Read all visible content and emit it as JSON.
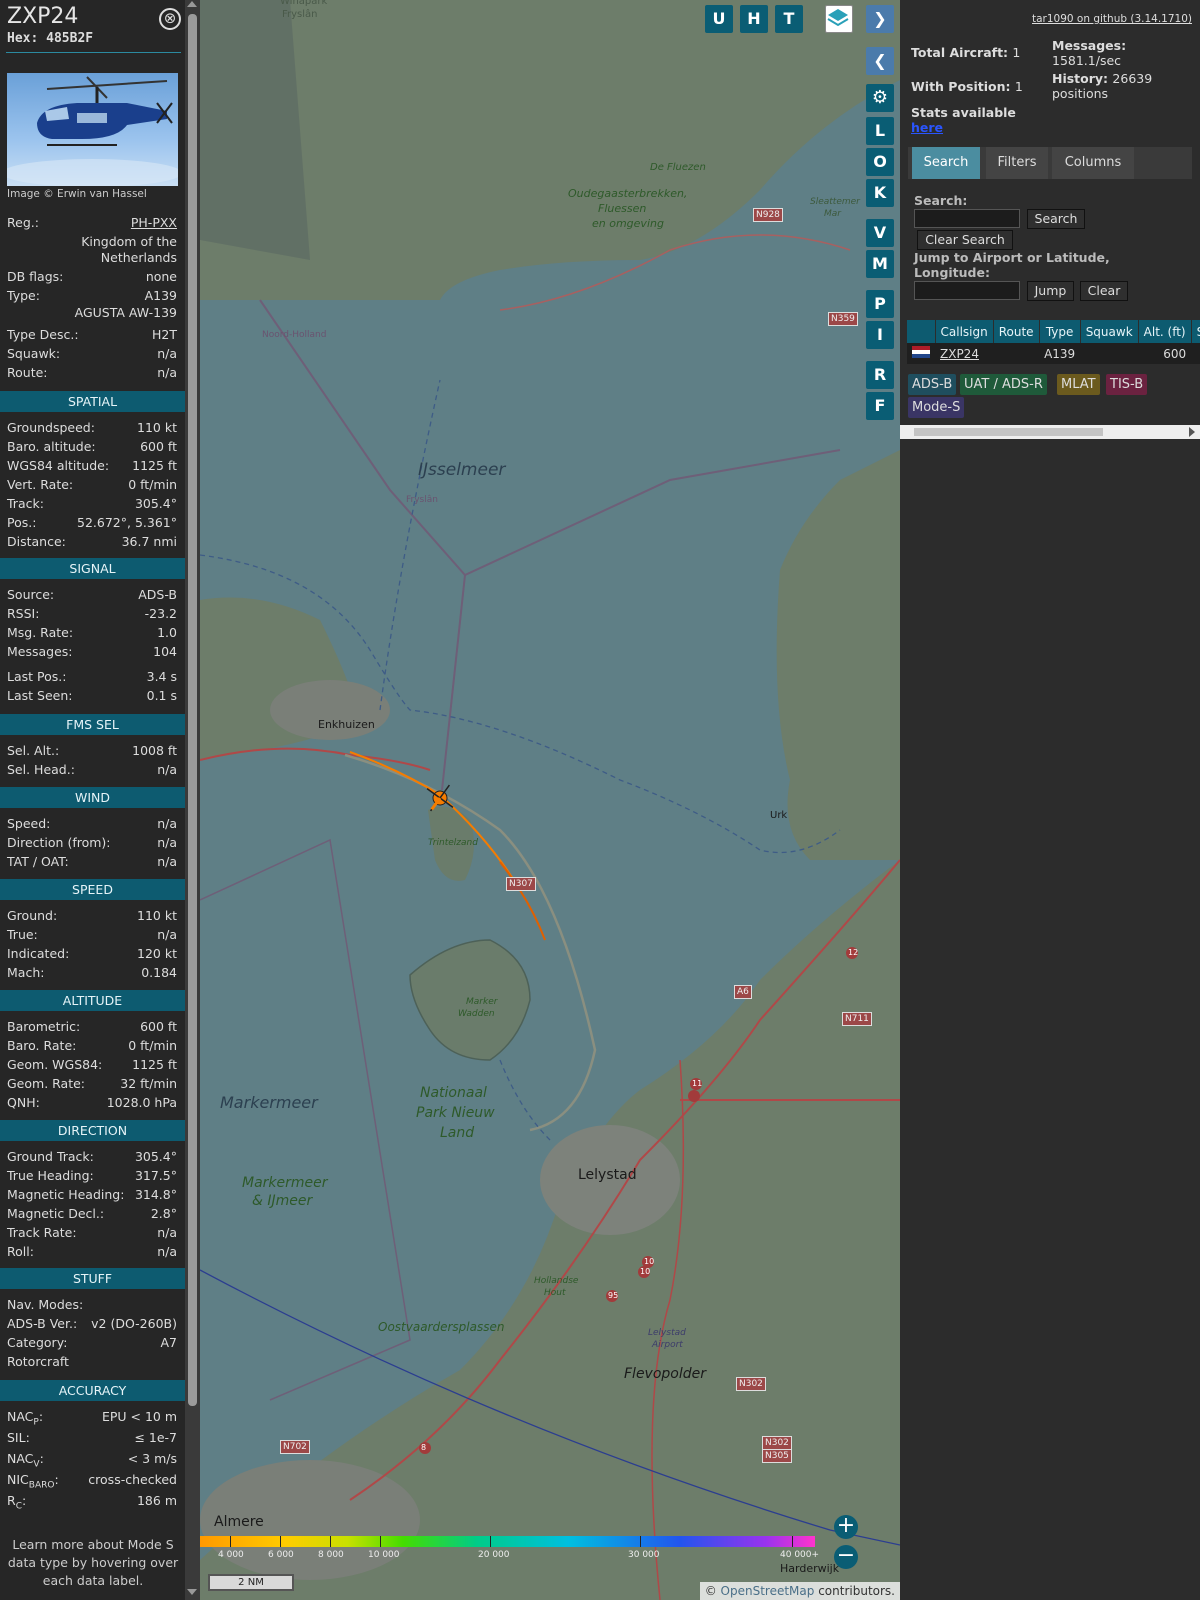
{
  "detail": {
    "callsign": "ZXP24",
    "hex_label": "Hex:",
    "hex": "485B2F",
    "close_glyph": "⊗",
    "photo_credit": "Image © Erwin van Hassel",
    "reg_label": "Reg.:",
    "reg": "PH-PXX",
    "country_line1": "Kingdom of the",
    "country_line2": "Netherlands",
    "rows_top": [
      {
        "k": "DB flags:",
        "v": "none"
      },
      {
        "k": "Type:",
        "v": "A139"
      }
    ],
    "type_full": "AGUSTA AW-139",
    "rows_type": [
      {
        "k": "Type Desc.:",
        "v": "H2T"
      },
      {
        "k": "Squawk:",
        "v": "n/a"
      },
      {
        "k": "Route:",
        "v": "n/a"
      }
    ],
    "sections": {
      "spatial": "SPATIAL",
      "signal": "SIGNAL",
      "fms": "FMS SEL",
      "wind": "WIND",
      "speed": "SPEED",
      "altitude": "ALTITUDE",
      "direction": "DIRECTION",
      "stuff": "STUFF",
      "accuracy": "ACCURACY"
    },
    "spatial": [
      {
        "k": "Groundspeed:",
        "v": "110 kt"
      },
      {
        "k": "Baro. altitude:",
        "v": "600 ft"
      },
      {
        "k": "WGS84 altitude:",
        "v": "1125 ft"
      },
      {
        "k": "Vert. Rate:",
        "v": "0 ft/min"
      },
      {
        "k": "Track:",
        "v": "305.4°"
      },
      {
        "k": "Pos.:",
        "v": "52.672°, 5.361°"
      },
      {
        "k": "Distance:",
        "v": "36.7 nmi"
      }
    ],
    "signal": [
      {
        "k": "Source:",
        "v": "ADS-B"
      },
      {
        "k": "RSSI:",
        "v": "-23.2"
      },
      {
        "k": "Msg. Rate:",
        "v": "1.0"
      },
      {
        "k": "Messages:",
        "v": "104"
      },
      {
        "k": "Last Pos.:",
        "v": "3.4 s"
      },
      {
        "k": "Last Seen:",
        "v": "0.1 s"
      }
    ],
    "fms": [
      {
        "k": "Sel. Alt.:",
        "v": "1008 ft"
      },
      {
        "k": "Sel. Head.:",
        "v": "n/a"
      }
    ],
    "wind": [
      {
        "k": "Speed:",
        "v": "n/a"
      },
      {
        "k": "Direction (from):",
        "v": "n/a"
      },
      {
        "k": "TAT / OAT:",
        "v": "n/a"
      }
    ],
    "speed": [
      {
        "k": "Ground:",
        "v": "110 kt"
      },
      {
        "k": "True:",
        "v": "n/a"
      },
      {
        "k": "Indicated:",
        "v": "120 kt"
      },
      {
        "k": "Mach:",
        "v": "0.184"
      }
    ],
    "altitude": [
      {
        "k": "Barometric:",
        "v": "600 ft"
      },
      {
        "k": "Baro. Rate:",
        "v": "0 ft/min"
      },
      {
        "k": "Geom. WGS84:",
        "v": "1125 ft"
      },
      {
        "k": "Geom. Rate:",
        "v": "32 ft/min"
      },
      {
        "k": "QNH:",
        "v": "1028.0 hPa"
      }
    ],
    "direction": [
      {
        "k": "Ground Track:",
        "v": "305.4°"
      },
      {
        "k": "True Heading:",
        "v": "317.5°"
      },
      {
        "k": "Magnetic Heading:",
        "v": "314.8°"
      },
      {
        "k": "Magnetic Decl.:",
        "v": "2.8°"
      },
      {
        "k": "Track Rate:",
        "v": "n/a"
      },
      {
        "k": "Roll:",
        "v": "n/a"
      }
    ],
    "stuff": [
      {
        "k": "Nav. Modes:",
        "v": ""
      },
      {
        "k": "ADS-B Ver.:",
        "v": "v2 (DO-260B)"
      },
      {
        "k": "Category:",
        "v": "A7"
      },
      {
        "k": "Rotorcraft",
        "v": ""
      }
    ],
    "accuracy": [
      {
        "k": "NAC",
        "sub": "P",
        "tail": ":",
        "v": "EPU < 10 m"
      },
      {
        "k": "SIL:",
        "sub": "",
        "tail": "",
        "v": "≤ 1e-7"
      },
      {
        "k": "NAC",
        "sub": "V",
        "tail": ":",
        "v": "< 3 m/s"
      },
      {
        "k": "NIC",
        "sub": "BARO",
        "tail": ":",
        "v": "cross-checked"
      },
      {
        "k": "R",
        "sub": "C",
        "tail": ":",
        "v": "186 m"
      }
    ],
    "learn_more": "Learn more about Mode S data type by hovering over each data label."
  },
  "map": {
    "place_labels": [
      {
        "name": "Winapark Fryslân",
        "text": "Winapark"
      },
      {
        "name": "Fryslan-north",
        "text": "Fryslân"
      },
      {
        "name": "De Fluezen",
        "text": "De Fluezen"
      },
      {
        "name": "Oudegaasterbrekken-1",
        "text": "Oudegaasterbrekken,"
      },
      {
        "name": "Oudegaasterbrekken-2",
        "text": "Fluessen"
      },
      {
        "name": "Oudegaasterbrekken-3",
        "text": "en omgeving"
      },
      {
        "name": "Slotermeer",
        "text": "Sleattemer"
      },
      {
        "name": "Slotermeer-2",
        "text": "Mar"
      },
      {
        "name": "Noord-Holland",
        "text": "Noord-Holland"
      },
      {
        "name": "Fryslan-lake",
        "text": "Fryslân"
      },
      {
        "name": "IJsselmeer",
        "text": "IJsselmeer"
      },
      {
        "name": "Enkhuizen",
        "text": "Enkhuizen"
      },
      {
        "name": "Trintelzand",
        "text": "Trintelzand"
      },
      {
        "name": "Urk",
        "text": "Urk"
      },
      {
        "name": "Marker Wadden-1",
        "text": "Marker"
      },
      {
        "name": "Marker Wadden-2",
        "text": "Wadden"
      },
      {
        "name": "Markermeer",
        "text": "Markermeer"
      },
      {
        "name": "Nationaal Park-1",
        "text": "Nationaal"
      },
      {
        "name": "Nationaal Park-2",
        "text": "Park Nieuw"
      },
      {
        "name": "Nationaal Park-3",
        "text": "Land"
      },
      {
        "name": "Markermeer IJmeer-1",
        "text": "Markermeer"
      },
      {
        "name": "Markermeer IJmeer-2",
        "text": "& IJmeer"
      },
      {
        "name": "Lelystad",
        "text": "Lelystad"
      },
      {
        "name": "Hollandse Hout-1",
        "text": "Hollandse"
      },
      {
        "name": "Hollandse Hout-2",
        "text": "Hout"
      },
      {
        "name": "Oostvaardersplassen",
        "text": "Oostvaardersplassen"
      },
      {
        "name": "Lelystad Airport-1",
        "text": "Lelystad"
      },
      {
        "name": "Lelystad Airport-2",
        "text": "Airport"
      },
      {
        "name": "Flevopolder",
        "text": "Flevopolder"
      },
      {
        "name": "Almere",
        "text": "Almere"
      },
      {
        "name": "Harderwijk",
        "text": "Harderwijk"
      }
    ],
    "road_shields": [
      "N928",
      "N359",
      "N307",
      "A6",
      "N711",
      "N302",
      "N302",
      "N305",
      "N702"
    ],
    "road_numbers": [
      "12",
      "11",
      "10",
      "10",
      "95",
      "8"
    ],
    "buttons_right": [
      "L",
      "O",
      "K",
      "V",
      "M",
      "P",
      "I",
      "R",
      "F"
    ],
    "buttons_top": [
      "U",
      "H",
      "T"
    ],
    "altitude_scale": [
      "4 000",
      "6 000",
      "8 000",
      "10 000",
      "20 000",
      "30 000",
      "40 000+"
    ],
    "scale_bar": "2 NM",
    "attribution_prefix": "© ",
    "attribution_link": "OpenStreetMap",
    "attribution_suffix": " contributors.",
    "zoom_in": "+",
    "zoom_out": "−",
    "colors": {
      "water": "#5f7f86",
      "land": "#6d7d6a",
      "track": "#f57c00",
      "aircraft": "#f57c00"
    }
  },
  "panel": {
    "github_link": "tar1090 on github (3.14.1710)",
    "total_aircraft_label": "Total Aircraft:",
    "total_aircraft": "1",
    "with_position_label": "With Position:",
    "with_position": "1",
    "stats_label": "Stats available",
    "stats_link": "here",
    "messages_label": "Messages:",
    "messages_rate": "1581.1/sec",
    "history_label": "History:",
    "history_value": "26639",
    "history_unit": "positions",
    "tabs": [
      "Search",
      "Filters",
      "Columns"
    ],
    "search_label": "Search:",
    "search_button": "Search",
    "clear_search_button": "Clear Search",
    "jump_label": "Jump to Airport or Latitude, Longitude:",
    "jump_button": "Jump",
    "clear_button": "Clear",
    "table_headers": [
      "",
      "Callsign",
      "Route",
      "Type",
      "Squawk",
      "Alt. (ft)",
      "Spd."
    ],
    "table_rows": [
      {
        "callsign": "ZXP24",
        "route": "",
        "type": "A139",
        "squawk": "",
        "alt": "600",
        "spd": ""
      }
    ],
    "source_tags": [
      {
        "text": "ADS-B",
        "color": "#1f4e5e"
      },
      {
        "text": "UAT / ADS-R",
        "color": "#1f5a3a"
      },
      {
        "text": "MLAT",
        "color": "#6b5a1e"
      },
      {
        "text": "TIS-B",
        "color": "#6b2240"
      },
      {
        "text": "Mode-S",
        "color": "#3a3565"
      }
    ]
  }
}
